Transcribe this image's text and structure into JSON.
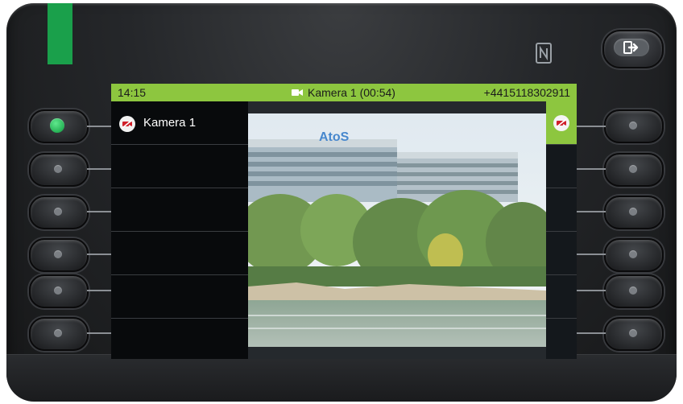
{
  "status_bar": {
    "time": "14:15",
    "call_label": "Kamera 1 (00:54)",
    "phone_number": "+4415118302911"
  },
  "list": {
    "items": [
      {
        "label": "Kamera 1",
        "icon": "camera-off-icon"
      },
      {
        "label": ""
      },
      {
        "label": ""
      },
      {
        "label": ""
      },
      {
        "label": ""
      },
      {
        "label": ""
      }
    ]
  },
  "video": {
    "logo_text": "AtoS"
  },
  "colors": {
    "accent": "#8dc63f",
    "led_green": "#1aa04b"
  }
}
